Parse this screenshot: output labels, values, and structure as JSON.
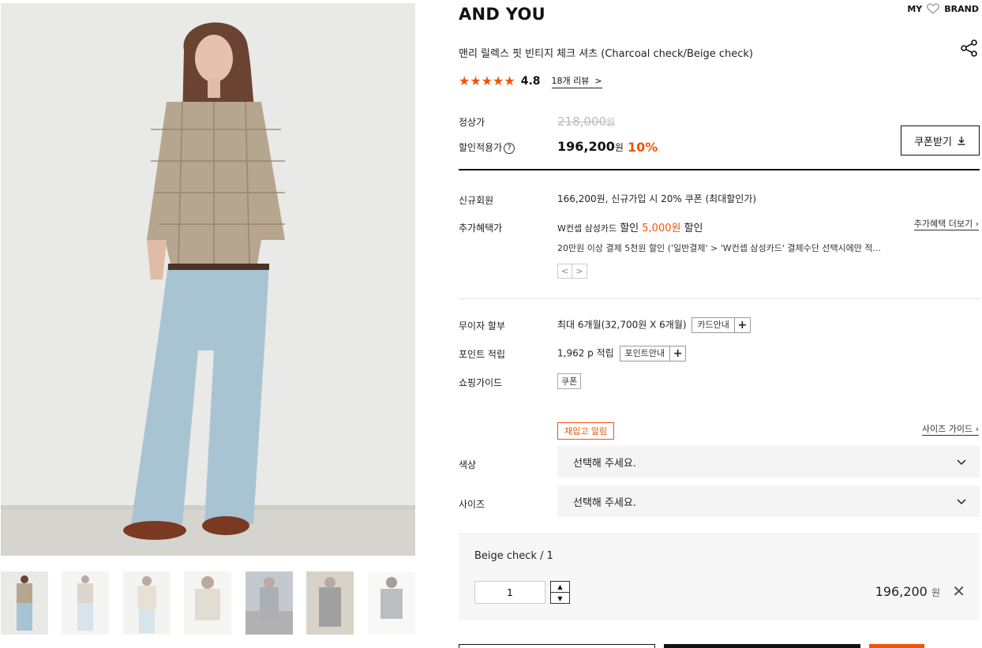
{
  "brand": "AND YOU",
  "top_links": {
    "my": "MY",
    "brand": "BRAND"
  },
  "product_name": "맨리 릴렉스 핏 빈티지 체크 셔츠 (Charcoal check/Beige check)",
  "rating": {
    "score": "4.8",
    "stars": 5,
    "review_count": "18",
    "review_suffix": "개 리뷰",
    "review_arrow": ">"
  },
  "price": {
    "regular_label": "정상가",
    "regular_value": "218,000",
    "regular_unit": "원",
    "sale_label": "할인적용가",
    "sale_value": "196,200",
    "sale_unit": "원",
    "discount": "10%",
    "coupon_button": "쿠폰받기"
  },
  "benefits": {
    "new_member_label": "신규회원",
    "new_member_value": "166,200원, 신규가입 시 20% 쿠폰 (최대할인가)",
    "extra_label": "추가혜택가",
    "extra_prefix": "W컨셉 삼성카드",
    "extra_mid": " 할인 ",
    "extra_amount": "5,000원",
    "extra_suffix": " 할인",
    "extra_more": "추가혜택 더보기",
    "extra_note": "20만원 이상 결제 5천원 할인 ('일반결제' > 'W컨셉 삼성카드' 결제수단 선택시에만 적...",
    "pager_prev": "<",
    "pager_next": ">"
  },
  "installment": {
    "label": "무이자 할부",
    "value": "최대 6개월(32,700원 X 6개월)",
    "button": "카드안내"
  },
  "points": {
    "label": "포인트 적립",
    "value": "1,962 p 적립",
    "button": "포인트안내"
  },
  "guide": {
    "label": "쇼핑가이드",
    "chip": "쿠폰"
  },
  "options": {
    "restock": "재입고 알림",
    "size_guide": "사이즈 가이드",
    "color_label": "색상",
    "color_placeholder": "선택해 주세요.",
    "size_label": "사이즈",
    "size_placeholder": "선택해 주세요."
  },
  "selected": {
    "option": "Beige check / 1",
    "qty": "1",
    "price": "196,200",
    "unit": "원",
    "remove": "✕"
  },
  "colors": {
    "accent": "#f0540a",
    "text": "#111111",
    "select_bg": "#f4f4f4"
  },
  "icons": [
    "heart-icon",
    "share-icon",
    "question-icon",
    "download-icon",
    "chevron-down-icon",
    "close-icon"
  ]
}
